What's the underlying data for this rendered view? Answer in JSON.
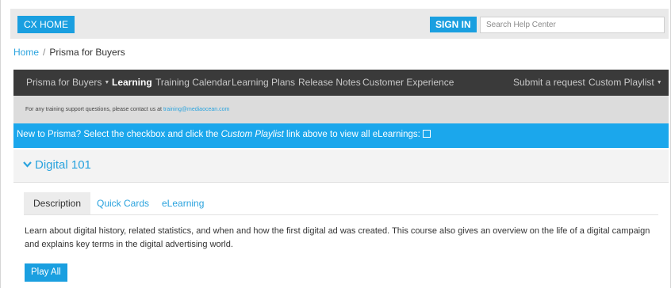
{
  "topbar": {
    "home_label": "CX HOME",
    "sign_in_label": "SIGN IN",
    "search_placeholder": "Search Help Center"
  },
  "breadcrumb": {
    "home": "Home",
    "separator": "/",
    "current": "Prisma for Buyers"
  },
  "nav": {
    "items": [
      {
        "label": "Prisma for Buyers",
        "has_caret": true
      },
      {
        "label": "Learning",
        "active": true
      },
      {
        "label": "Training Calendar"
      },
      {
        "label": "Learning Plans"
      },
      {
        "label": "Release Notes"
      },
      {
        "label": "Customer Experience"
      }
    ],
    "right": [
      {
        "label": "Submit a request"
      },
      {
        "label": "Custom Playlist",
        "has_caret": true
      }
    ],
    "caret_glyph": "▼"
  },
  "notice": {
    "text": "For any training support questions, please contact us at ",
    "email": "training@mediaocean.com"
  },
  "banner": {
    "text_before": "New to Prisma? Select the checkbox and click the ",
    "link_text": "Custom Playlist",
    "text_after": " link above to view all eLearnings:"
  },
  "course": {
    "title": "Digital 101",
    "chevron": "❯"
  },
  "tabs": [
    {
      "label": "Description",
      "active": true
    },
    {
      "label": "Quick Cards"
    },
    {
      "label": "eLearning"
    }
  ],
  "description": "Learn about digital history, related statistics, and when and how the first digital ad was created. This course also gives an overview on the life of a digital campaign and explains key terms in the digital advertising world.",
  "play_all_label": "Play All",
  "colors": {
    "accent": "#1a9fe0",
    "banner": "#1ba7ec",
    "nav_bg": "#3a3a3a",
    "link": "#2aa3de"
  }
}
